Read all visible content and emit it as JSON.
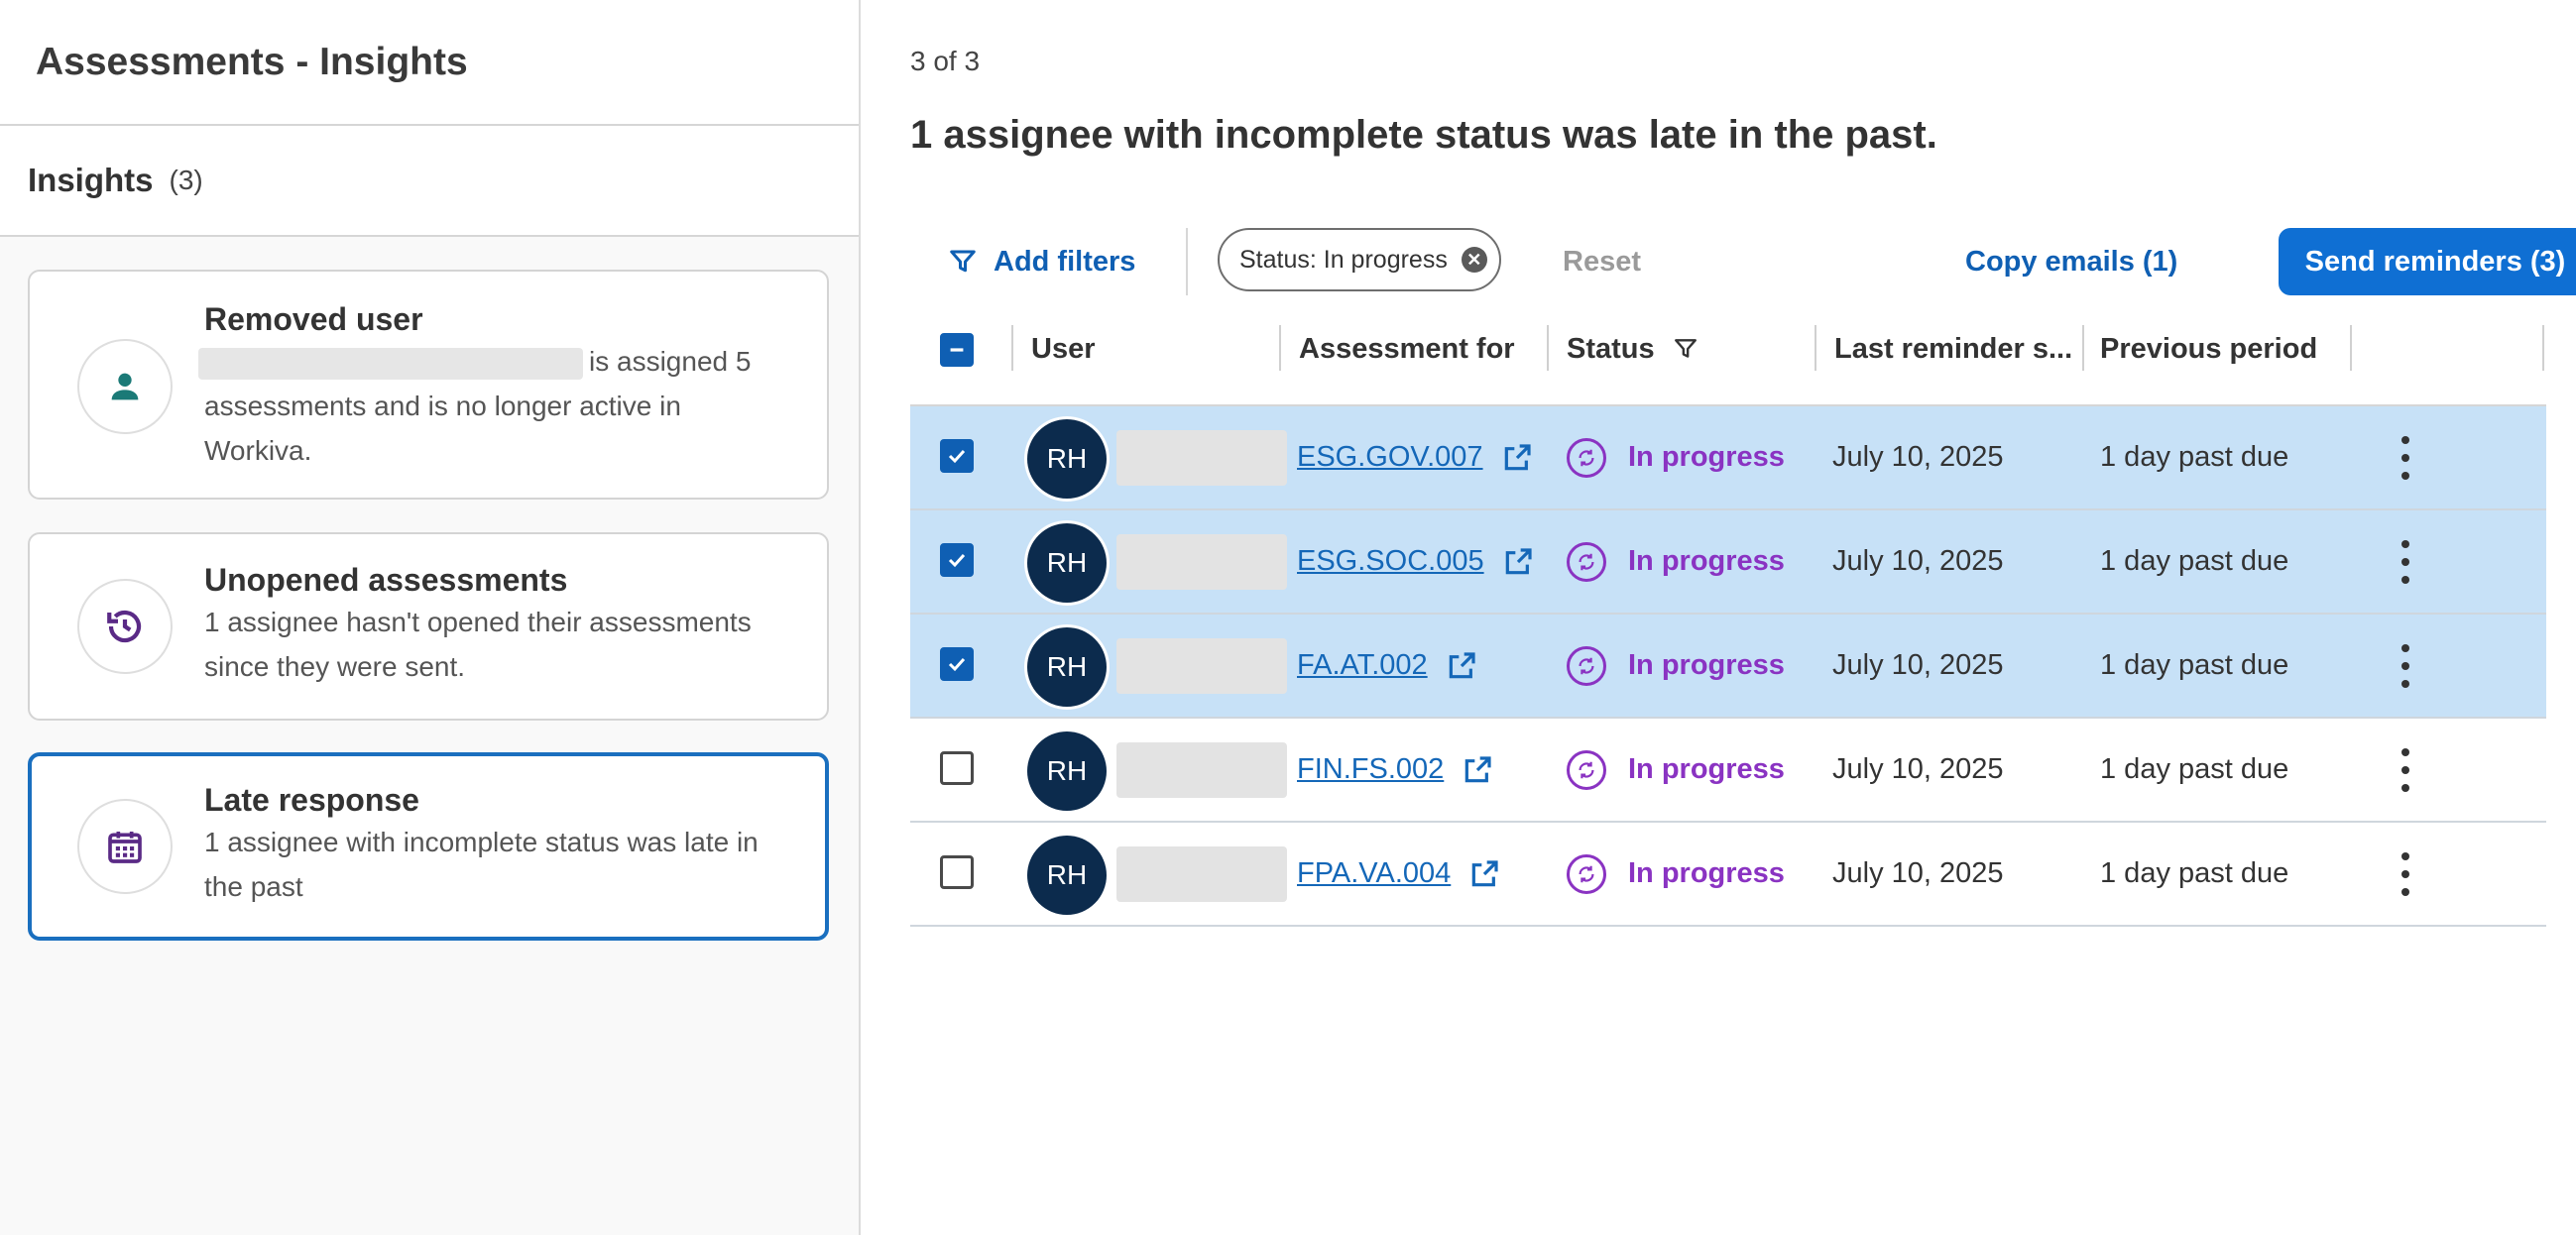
{
  "sidebar": {
    "title": "Assessments - Insights",
    "section_label": "Insights",
    "section_count": "(3)",
    "cards": [
      {
        "title": "Removed user",
        "desc": "is assigned 5 assessments and is no longer active in Workiva.",
        "icon": "user-icon",
        "selected": false
      },
      {
        "title": "Unopened assessments",
        "desc": "1 assignee hasn't opened their assessments since they were sent.",
        "icon": "history-icon",
        "selected": false
      },
      {
        "title": "Late response",
        "desc": "1 assignee with incomplete status was late in the past",
        "icon": "calendar-icon",
        "selected": true
      }
    ]
  },
  "main": {
    "counter": "3 of 3",
    "heading": "1 assignee with incomplete status was late in the past.",
    "toolbar": {
      "add_filters": "Add filters",
      "chip_label": "Status: In progress",
      "reset": "Reset",
      "copy_emails": "Copy emails (1)",
      "send_reminders": "Send reminders (3)"
    },
    "table": {
      "headers": {
        "user": "User",
        "assessment": "Assessment for",
        "status": "Status",
        "reminder": "Last reminder s...",
        "previous": "Previous period"
      },
      "rows": [
        {
          "initials": "RH",
          "assessment": "ESG.GOV.007",
          "status": "In progress",
          "reminder": "July 10, 2025",
          "previous": "1 day past due",
          "checked": true
        },
        {
          "initials": "RH",
          "assessment": "ESG.SOC.005",
          "status": "In progress",
          "reminder": "July 10, 2025",
          "previous": "1 day past due",
          "checked": true
        },
        {
          "initials": "RH",
          "assessment": "FA.AT.002",
          "status": "In progress",
          "reminder": "July 10, 2025",
          "previous": "1 day past due",
          "checked": true
        },
        {
          "initials": "RH",
          "assessment": "FIN.FS.002",
          "status": "In progress",
          "reminder": "July 10, 2025",
          "previous": "1 day past due",
          "checked": false
        },
        {
          "initials": "RH",
          "assessment": "FPA.VA.004",
          "status": "In progress",
          "reminder": "July 10, 2025",
          "previous": "1 day past due",
          "checked": false
        }
      ]
    }
  },
  "colors": {
    "accent": "#0f6fd3",
    "link": "#1467b8",
    "status": "#8a33c2",
    "avatar": "#0c2b4d",
    "selected_row": "#c7e1f7"
  }
}
